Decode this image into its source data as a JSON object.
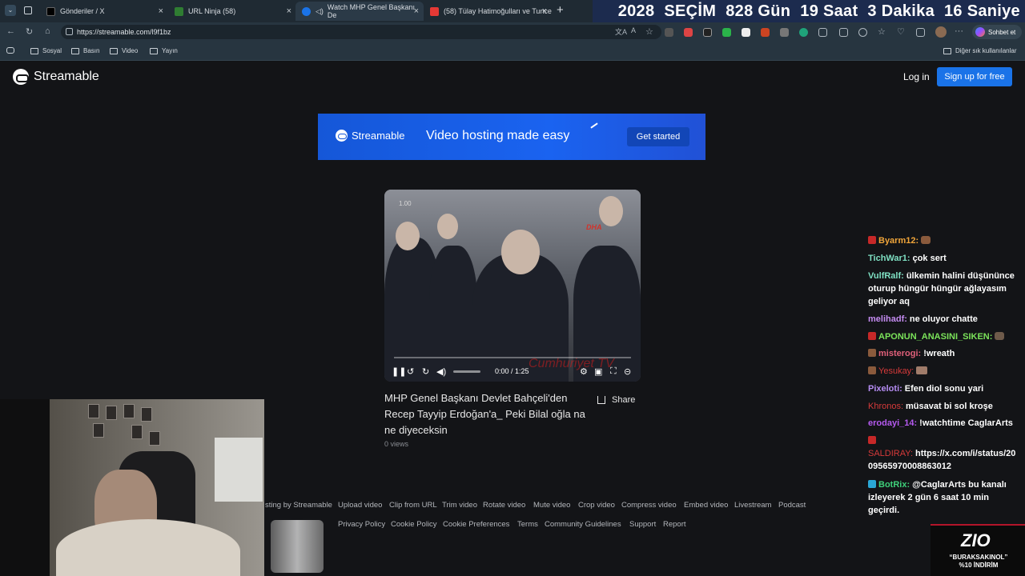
{
  "browser": {
    "tabs": [
      {
        "label": "Gönderiler / X",
        "favicon_color": "#000000"
      },
      {
        "label": "URL Ninja (58)",
        "favicon_color": "#2f7d32"
      },
      {
        "label": "Watch MHP Genel Başkanı De",
        "favicon_color": "#1a73e8"
      },
      {
        "label": "(58) Tülay Hatimoğulları ve Tunce",
        "favicon_color": "#e53935"
      }
    ],
    "new_tab": "+",
    "close": "×",
    "url": "https://streamable.com/l9f1bz",
    "chat_button": "Sohbet et",
    "bookmarks": [
      "Sosyal",
      "Basın",
      "Video",
      "Yayın"
    ],
    "other_bookmarks": "Diğer sık kullanılanlar"
  },
  "countdown": {
    "year": "2028",
    "label": "SEÇİM",
    "days": "828 Gün",
    "hours": "19 Saat",
    "minutes": "3 Dakika",
    "seconds": "16 Saniye"
  },
  "site": {
    "brand": "Streamable",
    "login": "Log in",
    "signup": "Sign up for free",
    "banner_brand": "Streamable",
    "banner_tagline": "Video hosting made easy",
    "banner_cta": "Get started"
  },
  "video": {
    "speed": "1.00",
    "channel_logo": "DHA",
    "watermark": "Cumhuriyet TV",
    "time": "0:00 / 1:25",
    "title": "MHP Genel Başkanı Devlet Bahçeli'den Recep Tayyip Erdoğan'a_ Peki Bilal oğla na ne diyeceksin",
    "views": "0 views",
    "share": "Share",
    "progress": 0.0
  },
  "footer": {
    "row1": [
      "sting by Streamable",
      "Upload video",
      "Clip from URL",
      "Trim video",
      "Rotate video",
      "Mute video",
      "Crop video",
      "Compress video",
      "Embed video",
      "Livestream",
      "Podcast"
    ],
    "row2": [
      "Privacy Policy",
      "Cookie Policy",
      "Cookie Preferences",
      "Terms",
      "Community Guidelines",
      "Support",
      "Report"
    ]
  },
  "chat": [
    {
      "user": "Byarm12:",
      "msg": "",
      "color": "#f0a53a",
      "badge": "#c62828"
    },
    {
      "user": "TichWar1:",
      "msg": "çok sert",
      "color": "#7fe0c3",
      "badge": ""
    },
    {
      "user": "VulfRalf:",
      "msg": "ülkemin halini düşününce oturup hüngür hüngür ağlayasım geliyor aq",
      "color": "#7fe0c3",
      "badge": ""
    },
    {
      "user": "melihadf:",
      "msg": "ne oluyor chatte",
      "color": "#c58cf2",
      "badge": ""
    },
    {
      "user": "APONUN_ANASINI_SIKEN:",
      "msg": "",
      "color": "#7be35a",
      "badge": "#c62828"
    },
    {
      "user": "misterogi:",
      "msg": "!wreath",
      "color": "#e0607a",
      "badge": "#8a5a3c"
    },
    {
      "user": "Yesukay:",
      "msg": "",
      "color": "#d63a3a",
      "badge": "#8a5a3c"
    },
    {
      "user": "Pixeloti:",
      "msg": "Efen diol sonu yari",
      "color": "#b58cf2",
      "badge": ""
    },
    {
      "user": "Khronos:",
      "msg": "müsavat bi sol kroşe",
      "color": "#d63a3a",
      "badge": ""
    },
    {
      "user": "erodayi_14:",
      "msg": "!watchtime CaglarArts",
      "color": "#b55af0",
      "badge": ""
    },
    {
      "user": "SALDIRAY:",
      "msg": "https://x.com/i/status/2009565970008863012",
      "color": "#d63a3a",
      "badge": "#c62828"
    },
    {
      "user": "BotRix:",
      "msg": "@CaglarArts bu kanalı izleyerek 2 gün 6 saat 10 min geçirdi.",
      "color": "#3fd07a",
      "badge": "#2aa7d6"
    }
  ],
  "sponsor": {
    "logo": "ZIO",
    "code": "“BURAKSAKINOL”",
    "discount": "%10 İNDİRİM"
  },
  "colors": {
    "accent": "#1a73e8",
    "page_bg": "#131417",
    "countdown_bg": "#1c2b4e"
  }
}
